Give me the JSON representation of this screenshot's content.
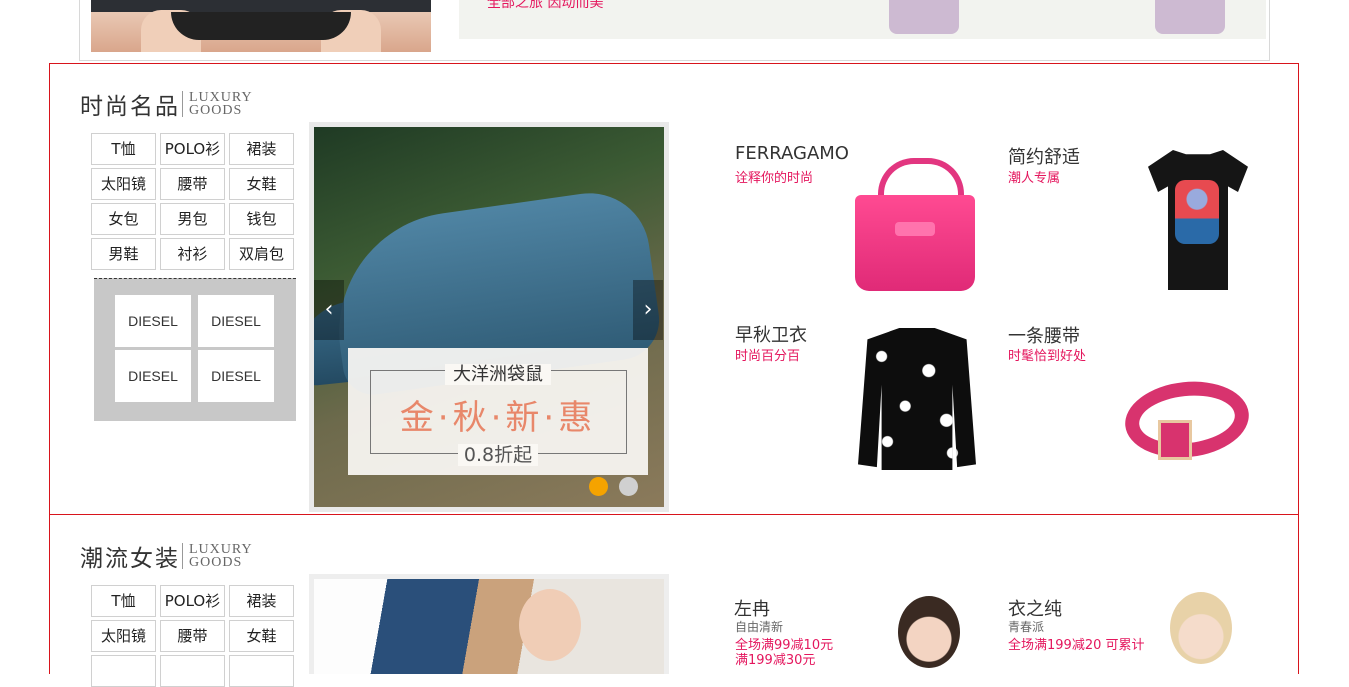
{
  "top": {
    "banner_text": "全部之旅 因动而美"
  },
  "sections": [
    {
      "title": "时尚名品",
      "sub_line1": "LUXURY",
      "sub_line2": "GOODS",
      "tags": [
        "T恤",
        "POLO衫",
        "裙装",
        "太阳镜",
        "腰带",
        "女鞋",
        "女包",
        "男包",
        "钱包",
        "男鞋",
        "衬衫",
        "双肩包"
      ],
      "brands": [
        "DIESEL",
        "DIESEL",
        "DIESEL",
        "DIESEL"
      ],
      "carousel": {
        "brand": "大洋洲袋鼠",
        "headline": "金·秋·新·惠",
        "discount": "0.8折起",
        "prev_icon": "‹",
        "next_icon": "›",
        "active_slide": 1,
        "total_slides": 2
      },
      "products": [
        {
          "title": "FERRAGAMO",
          "subtitle": "诠释你的时尚"
        },
        {
          "title": "简约舒适",
          "subtitle": "潮人专属"
        },
        {
          "title": "早秋卫衣",
          "subtitle": "时尚百分百"
        },
        {
          "title": "一条腰带",
          "subtitle": "时髦恰到好处"
        }
      ]
    },
    {
      "title": "潮流女装",
      "sub_line1": "LUXURY",
      "sub_line2": "GOODS",
      "tags": [
        "T恤",
        "POLO衫",
        "裙装",
        "太阳镜",
        "腰带",
        "女鞋"
      ],
      "products": [
        {
          "title": "左冉",
          "tagline": "自由清新",
          "promo": "全场满99减10元",
          "promo2": "满199减30元"
        },
        {
          "title": "衣之纯",
          "tagline": "青春派",
          "promo": "全场满199减20 可累计"
        }
      ]
    }
  ],
  "colors": {
    "accent": "#e4165d",
    "border": "#d8141c",
    "dot_active": "#f5a300",
    "dot_inactive": "#d0d0d0"
  }
}
